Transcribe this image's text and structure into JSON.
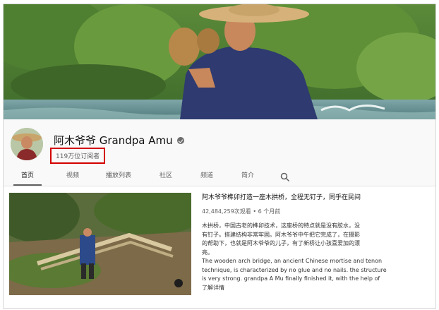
{
  "channel": {
    "name": "阿木爷爷 Grandpa Amu",
    "subscribers": "119万位订阅者"
  },
  "tabs": [
    {
      "label": "首页",
      "active": true
    },
    {
      "label": "视频"
    },
    {
      "label": "播放列表"
    },
    {
      "label": "社区"
    },
    {
      "label": "频道"
    },
    {
      "label": "简介"
    }
  ],
  "icons": {
    "search": "search-icon",
    "verified": "verified-check-icon"
  },
  "featured_video": {
    "title": "阿木爷爷榫卯打造一座木拱桥，全程无钉子，同乎在民间",
    "meta": "42,484,259次观看 • 6 个月前",
    "description_lines": [
      "木拱桥，中国古老的榫卯技术，这座桥的特点就是没有胶水，没",
      "有钉子。搭建结构非常牢固。阿木爷爷中午把它完成了，在摄影",
      "的帮助下，也就是阿木爷爷的儿子，有了新桥让小孩喜爱加的漂",
      "亮。",
      "The wooden arch bridge, an ancient Chinese mortise and tenon",
      "technique, is characterized by no glue and no nails. the structure",
      "is very strong. grandpa A Mu finally finished it, with the help of",
      "了解详情"
    ]
  },
  "colors": {
    "highlight_box": "#d40000",
    "tab_bar_bg": "#f9f9f9",
    "text_secondary": "#606060"
  }
}
